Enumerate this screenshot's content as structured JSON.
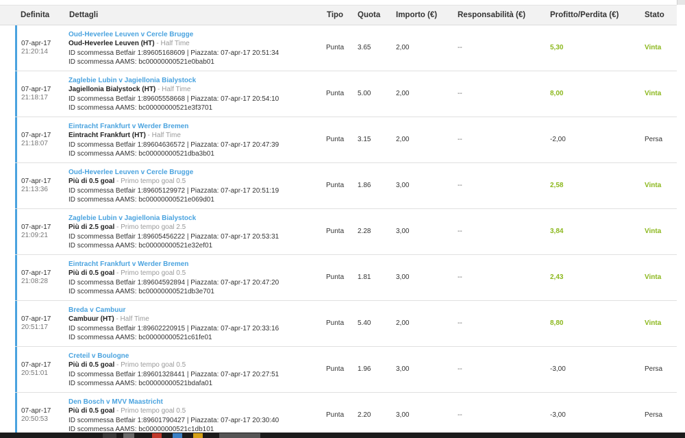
{
  "headers": {
    "definita": "Definita",
    "dettagli": "Dettagli",
    "tipo": "Tipo",
    "quota": "Quota",
    "importo": "Importo (€)",
    "responsabilita": "Responsabilità (€)",
    "profitto": "Profitto/Perdita (€)",
    "stato": "Stato"
  },
  "rows": [
    {
      "date": "07-apr-17",
      "time": "21:20:14",
      "event": "Oud-Heverlee Leuven v Cercle Brugge",
      "selection": "Oud-Heverlee Leuven (HT)",
      "market": " - Half Time",
      "id_betfair": "ID scommessa Betfair 1:89605168609 | Piazzata: 07-apr-17 20:51:34",
      "id_aams": "ID scommessa AAMS: bc00000000521e0bab01",
      "tipo": "Punta",
      "quota": "3.65",
      "importo": "2,00",
      "resp": "--",
      "pl": "5,30",
      "stato": "Vinta",
      "win": true
    },
    {
      "date": "07-apr-17",
      "time": "21:18:17",
      "event": "Zaglebie Lubin v Jagiellonia Bialystock",
      "selection": "Jagiellonia Bialystock (HT)",
      "market": " - Half Time",
      "id_betfair": "ID scommessa Betfair 1:89605558668 | Piazzata: 07-apr-17 20:54:10",
      "id_aams": "ID scommessa AAMS: bc00000000521e3f3701",
      "tipo": "Punta",
      "quota": "5.00",
      "importo": "2,00",
      "resp": "--",
      "pl": "8,00",
      "stato": "Vinta",
      "win": true
    },
    {
      "date": "07-apr-17",
      "time": "21:18:07",
      "event": "Eintracht Frankfurt v Werder Bremen",
      "selection": "Eintracht Frankfurt (HT)",
      "market": " - Half Time",
      "id_betfair": "ID scommessa Betfair 1:89604636572 | Piazzata: 07-apr-17 20:47:39",
      "id_aams": "ID scommessa AAMS: bc00000000521dba3b01",
      "tipo": "Punta",
      "quota": "3.15",
      "importo": "2,00",
      "resp": "--",
      "pl": "-2,00",
      "stato": "Persa",
      "win": false
    },
    {
      "date": "07-apr-17",
      "time": "21:13:36",
      "event": "Oud-Heverlee Leuven v Cercle Brugge",
      "selection": "Più di 0.5 goal",
      "market": " - Primo tempo goal 0.5",
      "id_betfair": "ID scommessa Betfair 1:89605129972 | Piazzata: 07-apr-17 20:51:19",
      "id_aams": "ID scommessa AAMS: bc00000000521e069d01",
      "tipo": "Punta",
      "quota": "1.86",
      "importo": "3,00",
      "resp": "--",
      "pl": "2,58",
      "stato": "Vinta",
      "win": true
    },
    {
      "date": "07-apr-17",
      "time": "21:09:21",
      "event": "Zaglebie Lubin v Jagiellonia Bialystock",
      "selection": "Più di 2.5 goal",
      "market": " - Primo tempo goal 2.5",
      "id_betfair": "ID scommessa Betfair 1:89605456222 | Piazzata: 07-apr-17 20:53:31",
      "id_aams": "ID scommessa AAMS: bc00000000521e32ef01",
      "tipo": "Punta",
      "quota": "2.28",
      "importo": "3,00",
      "resp": "--",
      "pl": "3,84",
      "stato": "Vinta",
      "win": true
    },
    {
      "date": "07-apr-17",
      "time": "21:08:28",
      "event": "Eintracht Frankfurt v Werder Bremen",
      "selection": "Più di 0.5 goal",
      "market": " - Primo tempo goal 0.5",
      "id_betfair": "ID scommessa Betfair 1:89604592894 | Piazzata: 07-apr-17 20:47:20",
      "id_aams": "ID scommessa AAMS: bc00000000521db3e701",
      "tipo": "Punta",
      "quota": "1.81",
      "importo": "3,00",
      "resp": "--",
      "pl": "2,43",
      "stato": "Vinta",
      "win": true
    },
    {
      "date": "07-apr-17",
      "time": "20:51:17",
      "event": "Breda v Cambuur",
      "selection": "Cambuur (HT)",
      "market": " - Half Time",
      "id_betfair": "ID scommessa Betfair 1:89602220915 | Piazzata: 07-apr-17 20:33:16",
      "id_aams": "ID scommessa AAMS: bc00000000521c61fe01",
      "tipo": "Punta",
      "quota": "5.40",
      "importo": "2,00",
      "resp": "--",
      "pl": "8,80",
      "stato": "Vinta",
      "win": true
    },
    {
      "date": "07-apr-17",
      "time": "20:51:01",
      "event": "Creteil v Boulogne",
      "selection": "Più di 0.5 goal",
      "market": " - Primo tempo goal 0.5",
      "id_betfair": "ID scommessa Betfair 1:89601328441 | Piazzata: 07-apr-17 20:27:51",
      "id_aams": "ID scommessa AAMS: bc00000000521bdafa01",
      "tipo": "Punta",
      "quota": "1.96",
      "importo": "3,00",
      "resp": "--",
      "pl": "-3,00",
      "stato": "Persa",
      "win": false
    },
    {
      "date": "07-apr-17",
      "time": "20:50:53",
      "event": "Den Bosch v MVV Maastricht",
      "selection": "Più di 0.5 goal",
      "market": " - Primo tempo goal 0.5",
      "id_betfair": "ID scommessa Betfair 1:89601790427 | Piazzata: 07-apr-17 20:30:40",
      "id_aams": "ID scommessa AAMS: bc00000000521c1db101",
      "tipo": "Punta",
      "quota": "2.20",
      "importo": "3,00",
      "resp": "--",
      "pl": "-3,00",
      "stato": "Persa",
      "win": false
    }
  ],
  "colors": {
    "accent": "#4aa3df",
    "win": "#8cb81e",
    "header_bg": "#f2f2f2"
  }
}
